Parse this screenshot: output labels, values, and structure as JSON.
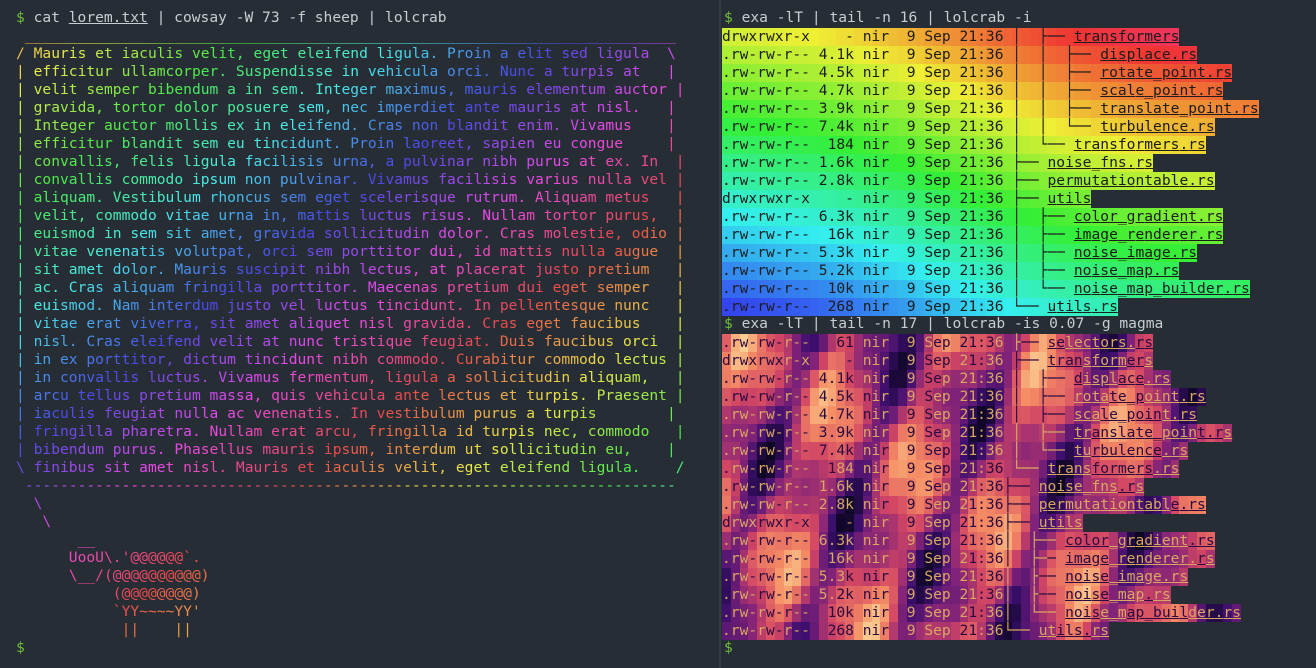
{
  "left_pane": {
    "prompt": "$",
    "command_pre": "cat ",
    "command_file": "lorem.txt",
    "command_post": " | cowsay -W 73 -f sheep | lolcrab",
    "bubble_top": " __________________________________________________________________________",
    "bubble_lines": [
      "/ Mauris et iaculis velit, eget eleifend ligula. Proin a elit sed ligula  \\",
      "| efficitur ullamcorper. Suspendisse in vehicula orci. Nunc a turpis at   |",
      "| velit semper bibendum a in sem. Integer maximus, mauris elementum auctor |",
      "| gravida, tortor dolor posuere sem, nec imperdiet ante mauris at nisl.   |",
      "| Integer auctor mollis ex in eleifend. Cras non blandit enim. Vivamus    |",
      "| efficitur blandit sem eu tincidunt. Proin laoreet, sapien eu congue     |",
      "| convallis, felis ligula facilisis urna, a pulvinar nibh purus at ex. In  |",
      "| convallis commodo ipsum non pulvinar. Vivamus facilisis varius nulla vel |",
      "| aliquam. Vestibulum rhoncus sem eget scelerisque rutrum. Aliquam metus   |",
      "| velit, commodo vitae urna in, mattis luctus risus. Nullam tortor purus,  |",
      "| euismod in sem sit amet, gravida sollicitudin dolor. Cras molestie, odio |",
      "| vitae venenatis volutpat, orci sem porttitor dui, id mattis nulla augue  |",
      "| sit amet dolor. Mauris suscipit nibh lectus, at placerat justo pretium   |",
      "| ac. Cras aliquam fringilla porttitor. Maecenas pretium dui eget semper   |",
      "| euismod. Nam interdum justo vel luctus tincidunt. In pellentesque nunc   |",
      "| vitae erat viverra, sit amet aliquet nisl gravida. Cras eget faucibus    |",
      "| nisl. Cras eleifend velit at nunc tristique feugiat. Duis faucibus orci  |",
      "| in ex porttitor, dictum tincidunt nibh commodo. Curabitur commodo lectus |",
      "| in convallis luctus. Vivamus fermentum, ligula a sollicitudin aliquam,   |",
      "| arcu tellus pretium massa, quis vehicula ante lectus et turpis. Praesent |",
      "| iaculis feugiat nulla ac venenatis. In vestibulum purus a turpis        |",
      "| fringilla pharetra. Nullam erat arcu, fringilla id turpis nec, commodo   |",
      "| bibendum purus. Phasellus mauris ipsum, interdum ut sollicitudin eu,    |",
      "\\ finibus sit amet nisl. Mauris et iaculis velit, eget eleifend ligula.    /",
      " --------------------------------------------------------------------------"
    ],
    "sheep_lines": [
      "  \\",
      "   \\",
      "       __",
      "      UooU\\.'@@@@@@`.",
      "      \\__/(@@@@@@@@@@)",
      "           (@@@@@@@@)",
      "           `YY~~~~YY'",
      "            ||    ||"
    ],
    "final_prompt": "$"
  },
  "right_pane": {
    "cmd1": {
      "prompt": "$",
      "text": " exa -lT | tail -n 16 | lolcrab -i"
    },
    "cmd2": {
      "prompt": "$",
      "text": " exa -lT | tail -n 17 | lolcrab -is 0.07 -g magma"
    },
    "rows1": [
      {
        "perm": "drwxrwxr-x",
        "size": "   -",
        "user": "nir",
        "day": " 9",
        "mon": "Sep",
        "time": "21:36",
        "tree": " │  ├── ",
        "name": "transformers"
      },
      {
        "perm": ".rw-rw-r--",
        "size": "4.1k",
        "user": "nir",
        "day": " 9",
        "mon": "Sep",
        "time": "21:36",
        "tree": " │  │  ├── ",
        "name": "displace.rs"
      },
      {
        "perm": ".rw-rw-r--",
        "size": "4.5k",
        "user": "nir",
        "day": " 9",
        "mon": "Sep",
        "time": "21:36",
        "tree": " │  │  ├── ",
        "name": "rotate_point.rs"
      },
      {
        "perm": ".rw-rw-r--",
        "size": "4.7k",
        "user": "nir",
        "day": " 9",
        "mon": "Sep",
        "time": "21:36",
        "tree": " │  │  ├── ",
        "name": "scale_point.rs"
      },
      {
        "perm": ".rw-rw-r--",
        "size": "3.9k",
        "user": "nir",
        "day": " 9",
        "mon": "Sep",
        "time": "21:36",
        "tree": " │  │  ├── ",
        "name": "translate_point.rs"
      },
      {
        "perm": ".rw-rw-r--",
        "size": "7.4k",
        "user": "nir",
        "day": " 9",
        "mon": "Sep",
        "time": "21:36",
        "tree": " │  │  └── ",
        "name": "turbulence.rs"
      },
      {
        "perm": ".rw-rw-r--",
        "size": " 184",
        "user": "nir",
        "day": " 9",
        "mon": "Sep",
        "time": "21:36",
        "tree": " │  └── ",
        "name": "transformers.rs"
      },
      {
        "perm": ".rw-rw-r--",
        "size": "1.6k",
        "user": "nir",
        "day": " 9",
        "mon": "Sep",
        "time": "21:36",
        "tree": " ├── ",
        "name": "noise_fns.rs"
      },
      {
        "perm": ".rw-rw-r--",
        "size": "2.8k",
        "user": "nir",
        "day": " 9",
        "mon": "Sep",
        "time": "21:36",
        "tree": " ├── ",
        "name": "permutationtable.rs"
      },
      {
        "perm": "drwxrwxr-x",
        "size": "   -",
        "user": "nir",
        "day": " 9",
        "mon": "Sep",
        "time": "21:36",
        "tree": " ├── ",
        "name": "utils"
      },
      {
        "perm": ".rw-rw-r--",
        "size": "6.3k",
        "user": "nir",
        "day": " 9",
        "mon": "Sep",
        "time": "21:36",
        "tree": " │  ├── ",
        "name": "color_gradient.rs"
      },
      {
        "perm": ".rw-rw-r--",
        "size": " 16k",
        "user": "nir",
        "day": " 9",
        "mon": "Sep",
        "time": "21:36",
        "tree": " │  ├── ",
        "name": "image_renderer.rs"
      },
      {
        "perm": ".rw-rw-r--",
        "size": "5.3k",
        "user": "nir",
        "day": " 9",
        "mon": "Sep",
        "time": "21:36",
        "tree": " │  ├── ",
        "name": "noise_image.rs"
      },
      {
        "perm": ".rw-rw-r--",
        "size": "5.2k",
        "user": "nir",
        "day": " 9",
        "mon": "Sep",
        "time": "21:36",
        "tree": " │  ├── ",
        "name": "noise_map.rs"
      },
      {
        "perm": ".rw-rw-r--",
        "size": " 10k",
        "user": "nir",
        "day": " 9",
        "mon": "Sep",
        "time": "21:36",
        "tree": " │  └── ",
        "name": "noise_map_builder.rs"
      },
      {
        "perm": ".rw-rw-r--",
        "size": " 268",
        "user": "nir",
        "day": " 9",
        "mon": "Sep",
        "time": "21:36",
        "tree": " └── ",
        "name": "utils.rs"
      }
    ],
    "rows2": [
      {
        "perm": ".rw-rw-r--",
        "size": "  61",
        "user": "nir",
        "day": " 9",
        "mon": "Sep",
        "time": "21:36",
        "tree": " ├── ",
        "name": "selectors.rs"
      },
      {
        "perm": "drwxrwxr-x",
        "size": "   -",
        "user": "nir",
        "day": " 9",
        "mon": "Sep",
        "time": "21:36",
        "tree": " ├── ",
        "name": "transformers"
      },
      {
        "perm": ".rw-rw-r--",
        "size": "4.1k",
        "user": "nir",
        "day": " 9",
        "mon": "Sep",
        "time": "21:36",
        "tree": " │  ├── ",
        "name": "displace.rs"
      },
      {
        "perm": ".rw-rw-r--",
        "size": "4.5k",
        "user": "nir",
        "day": " 9",
        "mon": "Sep",
        "time": "21:36",
        "tree": " │  ├── ",
        "name": "rotate_point.rs"
      },
      {
        "perm": ".rw-rw-r--",
        "size": "4.7k",
        "user": "nir",
        "day": " 9",
        "mon": "Sep",
        "time": "21:36",
        "tree": " │  ├── ",
        "name": "scale_point.rs"
      },
      {
        "perm": ".rw-rw-r--",
        "size": "3.9k",
        "user": "nir",
        "day": " 9",
        "mon": "Sep",
        "time": "21:36",
        "tree": " │  ├── ",
        "name": "translate_point.rs"
      },
      {
        "perm": ".rw-rw-r--",
        "size": "7.4k",
        "user": "nir",
        "day": " 9",
        "mon": "Sep",
        "time": "21:36",
        "tree": " │  └── ",
        "name": "turbulence.rs"
      },
      {
        "perm": ".rw-rw-r--",
        "size": " 184",
        "user": "nir",
        "day": " 9",
        "mon": "Sep",
        "time": "21:36",
        "tree": " └── ",
        "name": "transformers.rs"
      },
      {
        "perm": ".rw-rw-r--",
        "size": "1.6k",
        "user": "nir",
        "day": " 9",
        "mon": "Sep",
        "time": "21:36",
        "tree": "├── ",
        "name": "noise_fns.rs"
      },
      {
        "perm": ".rw-rw-r--",
        "size": "2.8k",
        "user": "nir",
        "day": " 9",
        "mon": "Sep",
        "time": "21:36",
        "tree": "├── ",
        "name": "permutationtable.rs"
      },
      {
        "perm": "drwxrwxr-x",
        "size": "   -",
        "user": "nir",
        "day": " 9",
        "mon": "Sep",
        "time": "21:36",
        "tree": "├── ",
        "name": "utils"
      },
      {
        "perm": ".rw-rw-r--",
        "size": "6.3k",
        "user": "nir",
        "day": " 9",
        "mon": "Sep",
        "time": "21:36",
        "tree": "│  ├── ",
        "name": "color_gradient.rs"
      },
      {
        "perm": ".rw-rw-r--",
        "size": " 16k",
        "user": "nir",
        "day": " 9",
        "mon": "Sep",
        "time": "21:36",
        "tree": "│  ├── ",
        "name": "image_renderer.rs"
      },
      {
        "perm": ".rw-rw-r--",
        "size": "5.3k",
        "user": "nir",
        "day": " 9",
        "mon": "Sep",
        "time": "21:36",
        "tree": "│  ├── ",
        "name": "noise_image.rs"
      },
      {
        "perm": ".rw-rw-r--",
        "size": "5.2k",
        "user": "nir",
        "day": " 9",
        "mon": "Sep",
        "time": "21:36",
        "tree": "│  ├── ",
        "name": "noise_map.rs"
      },
      {
        "perm": ".rw-rw-r--",
        "size": " 10k",
        "user": "nir",
        "day": " 9",
        "mon": "Sep",
        "time": "21:36",
        "tree": "│  └── ",
        "name": "noise_map_builder.rs"
      },
      {
        "perm": ".rw-rw-r--",
        "size": " 268",
        "user": "nir",
        "day": " 9",
        "mon": "Sep",
        "time": "21:36",
        "tree": "└── ",
        "name": "utils.rs"
      }
    ],
    "final_prompt": "$"
  },
  "colors": {
    "background": "#262d35",
    "divider": "#343c45",
    "prompt_green": "#6fbf3a",
    "command_text": "#c8cdd2"
  }
}
